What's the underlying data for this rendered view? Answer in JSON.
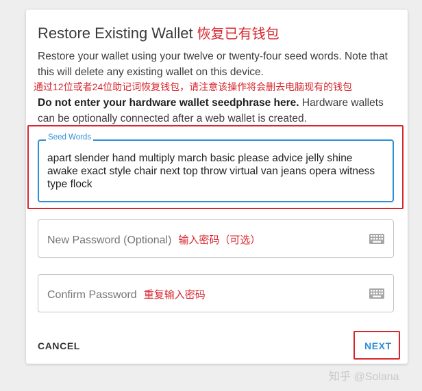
{
  "dialog": {
    "title": "Restore Existing Wallet",
    "title_annotation": "恢复已有钱包",
    "description": "Restore your wallet using your twelve or twenty-four seed words. Note that this will delete any existing wallet on this device.",
    "description_annotation": "通过12位或者24位助记词恢复钱包，请注意该操作将会删去电脑现有的钱包",
    "warning_bold": "Do not enter your hardware wallet seedphrase here.",
    "warning_rest": " Hardware wallets can be optionally connected after a web wallet is created."
  },
  "seed_field": {
    "label": "Seed Words",
    "value": "apart slender hand multiply march basic please advice jelly shine awake exact style chair next top throw virtual van jeans opera witness type flock"
  },
  "new_password": {
    "placeholder": "New Password (Optional)",
    "annotation": "输入密码（可选）",
    "icon": "keyboard-icon"
  },
  "confirm_password": {
    "placeholder": "Confirm Password",
    "annotation": "重复输入密码",
    "icon": "keyboard-icon"
  },
  "actions": {
    "cancel_label": "CANCEL",
    "next_label": "NEXT"
  },
  "watermark": "知乎 @Solana",
  "colors": {
    "accent": "#2e8fd6",
    "annotation_red": "#d8262e",
    "background": "#eeeeee"
  }
}
